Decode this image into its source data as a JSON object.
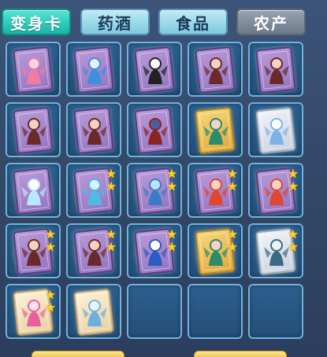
{
  "tabs": [
    {
      "label": "变身卡",
      "state": "active"
    },
    {
      "label": "药酒",
      "state": "normal"
    },
    {
      "label": "食品",
      "state": "normal"
    },
    {
      "label": "农产",
      "state": "dark"
    }
  ],
  "colors": {
    "active_tab": "#17b4a6",
    "normal_tab": "#7fc8dd",
    "dark_tab": "#6d7888",
    "slot_border": "#6fb3df",
    "star": "#ffd21f",
    "purple_card": "#9474c0",
    "gold_card": "#e0a93c"
  },
  "inventory": {
    "columns": 5,
    "slots": [
      {
        "card": "purple",
        "icon": "pink-flower-girl-icon",
        "stars": 0,
        "glow": false
      },
      {
        "card": "purple",
        "icon": "blue-hair-maiden-icon",
        "stars": 0,
        "glow": false
      },
      {
        "card": "purple",
        "icon": "panda-icon",
        "stars": 0,
        "glow": false
      },
      {
        "card": "purple",
        "icon": "bat-wing-girl-icon",
        "stars": 0,
        "glow": false
      },
      {
        "card": "purple",
        "icon": "bat-wing-girl-icon",
        "stars": 0,
        "glow": false
      },
      {
        "card": "purple",
        "icon": "bat-wing-girl-icon",
        "stars": 0,
        "glow": false
      },
      {
        "card": "purple",
        "icon": "bat-wing-girl-icon",
        "stars": 0,
        "glow": false
      },
      {
        "card": "purple",
        "icon": "armored-warrior-icon",
        "stars": 0,
        "glow": false
      },
      {
        "card": "gold",
        "icon": "fox-fairy-icon",
        "stars": 0,
        "glow": false
      },
      {
        "card": "white",
        "icon": "ice-beast-icon",
        "stars": 0,
        "glow": false
      },
      {
        "card": "purple",
        "icon": "crystal-spirit-icon",
        "stars": 0,
        "glow": true
      },
      {
        "card": "purple",
        "icon": "ice-peacock-icon",
        "stars": 2,
        "glow": true
      },
      {
        "card": "purple",
        "icon": "water-spirit-icon",
        "stars": 2,
        "glow": true
      },
      {
        "card": "purple",
        "icon": "red-hair-girl-icon",
        "stars": 2,
        "glow": true
      },
      {
        "card": "purple",
        "icon": "red-hair-girl-icon",
        "stars": 2,
        "glow": true
      },
      {
        "card": "purple",
        "icon": "bat-wing-girl-icon",
        "stars": 2,
        "glow": true
      },
      {
        "card": "purple",
        "icon": "bat-wing-girl-icon",
        "stars": 2,
        "glow": true
      },
      {
        "card": "purple",
        "icon": "snow-wizard-icon",
        "stars": 2,
        "glow": true
      },
      {
        "card": "gold",
        "icon": "fox-fairy-icon",
        "stars": 2,
        "glow": true
      },
      {
        "card": "white",
        "icon": "horned-knight-icon",
        "stars": 2,
        "glow": true
      },
      {
        "card": "cream",
        "icon": "pink-dancer-icon",
        "stars": 2,
        "glow": false
      },
      {
        "card": "cream",
        "icon": "frost-wolf-icon",
        "stars": 0,
        "glow": false
      },
      {
        "card": null,
        "icon": "empty-slot",
        "stars": 0,
        "glow": false
      },
      {
        "card": null,
        "icon": "empty-slot",
        "stars": 0,
        "glow": false
      },
      {
        "card": null,
        "icon": "empty-slot",
        "stars": 0,
        "glow": false
      }
    ]
  },
  "star_glyph": "★"
}
